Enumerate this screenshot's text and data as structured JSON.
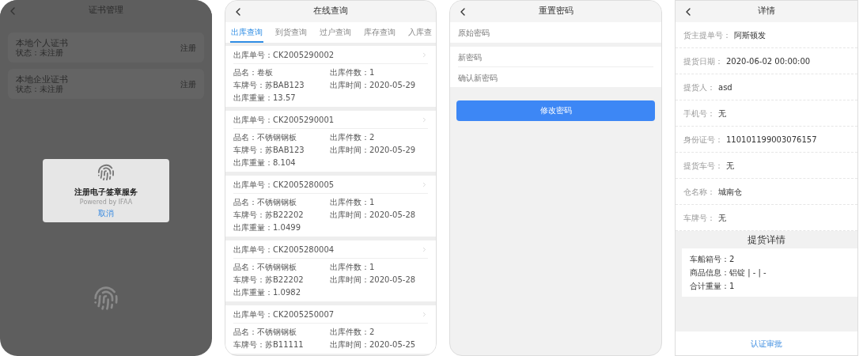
{
  "certificate_screen": {
    "title": "证书管理",
    "certificates": [
      {
        "name": "本地个人证书",
        "status": "状态：未注册",
        "action": "注册"
      },
      {
        "name": "本地企业证书",
        "status": "状态：未注册",
        "action": "注册"
      }
    ],
    "dialog": {
      "title": "注册电子签章服务",
      "subtitle": "Powered by IFAA",
      "cancel": "取消"
    }
  },
  "query_screen": {
    "title": "在线查询",
    "tabs": [
      {
        "label": "出库查询",
        "selected": true
      },
      {
        "label": "到货查询",
        "selected": false
      },
      {
        "label": "过户查询",
        "selected": false
      },
      {
        "label": "库存查询",
        "selected": false
      },
      {
        "label": "入库查",
        "selected": false
      }
    ],
    "records": [
      {
        "number": "出库单号：CK2005290002",
        "fields": [
          "品名：卷板",
          "出库件数：1",
          "车牌号：苏BAB123",
          "出库时间：2020-05-29",
          "出库重量：13.57"
        ]
      },
      {
        "number": "出库单号：CK2005290001",
        "fields": [
          "品名：不锈钢钢板",
          "出库件数：2",
          "车牌号：苏BAB123",
          "出库时间：2020-05-29",
          "出库重量：8.104"
        ]
      },
      {
        "number": "出库单号：CK2005280005",
        "fields": [
          "品名：不锈钢钢板",
          "出库件数：1",
          "车牌号：苏B22202",
          "出库时间：2020-05-28",
          "出库重量：1.0499"
        ]
      },
      {
        "number": "出库单号：CK2005280004",
        "fields": [
          "品名：不锈钢钢板",
          "出库件数：1",
          "车牌号：苏B22202",
          "出库时间：2020-05-28",
          "出库重量：1.0982"
        ]
      },
      {
        "number": "出库单号：CK2005250007",
        "fields": [
          "品名：不锈钢钢板",
          "出库件数：2",
          "车牌号：苏B11111",
          "出库时间：2020-05-25"
        ]
      }
    ]
  },
  "password_screen": {
    "title": "重置密码",
    "fields": [
      {
        "placeholder": "原始密码"
      },
      {
        "placeholder": "新密码"
      },
      {
        "placeholder": "确认新密码"
      }
    ],
    "submit": "修改密码"
  },
  "detail_screen": {
    "title": "详情",
    "rows": [
      {
        "label": "货主提单号：",
        "value": "阿斯顿发"
      },
      {
        "label": "提货日期：",
        "value": "2020-06-02 00:00:00"
      },
      {
        "label": "提货人：",
        "value": "asd"
      },
      {
        "label": "手机号：",
        "value": "无"
      },
      {
        "label": "身份证号：",
        "value": "110101199003076157"
      },
      {
        "label": "提货车号：",
        "value": "无"
      },
      {
        "label": "仓名称：",
        "value": "城南仓"
      },
      {
        "label": "车牌号：",
        "value": "无"
      }
    ],
    "section_title": "提货详情",
    "items": [
      "车船箱号：2",
      "商品信息：铝锭 | - | -",
      "合计重量：1"
    ],
    "approve": "认证审批"
  }
}
